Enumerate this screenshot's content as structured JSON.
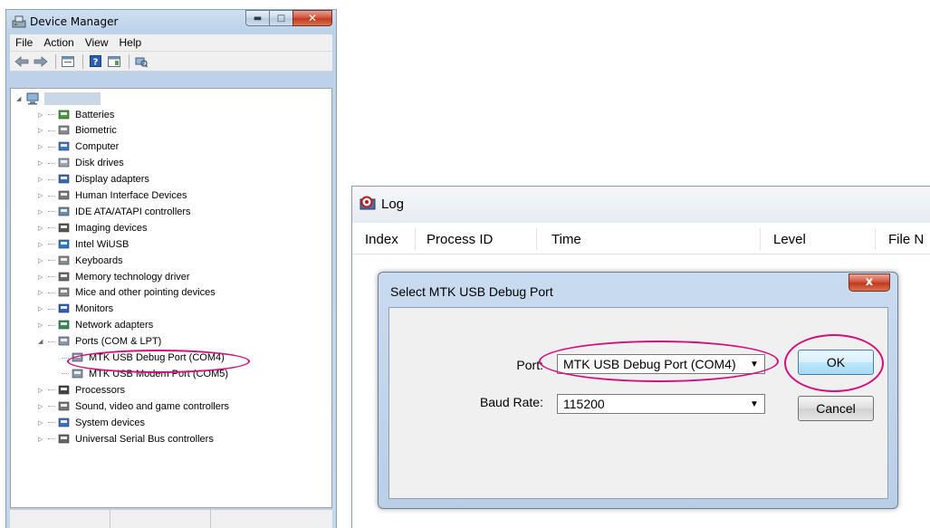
{
  "device_manager": {
    "title": "Device Manager",
    "menu": [
      "File",
      "Action",
      "View",
      "Help"
    ],
    "toolbar_icons": [
      "back-arrow-icon",
      "forward-arrow-icon",
      "properties-icon",
      "help-icon",
      "show-hide-icon",
      "scan-hardware-icon"
    ],
    "tree": {
      "categories": [
        {
          "label": "Batteries",
          "icon": "battery-icon"
        },
        {
          "label": "Biometric",
          "icon": "biometric-icon"
        },
        {
          "label": "Computer",
          "icon": "computer-icon"
        },
        {
          "label": "Disk drives",
          "icon": "disk-drive-icon"
        },
        {
          "label": "Display adapters",
          "icon": "display-adapter-icon"
        },
        {
          "label": "Human Interface Devices",
          "icon": "hid-icon"
        },
        {
          "label": "IDE ATA/ATAPI controllers",
          "icon": "ide-controller-icon"
        },
        {
          "label": "Imaging devices",
          "icon": "camera-icon"
        },
        {
          "label": "Intel WiUSB",
          "icon": "usb-network-icon"
        },
        {
          "label": "Keyboards",
          "icon": "keyboard-icon"
        },
        {
          "label": "Memory technology driver",
          "icon": "memory-icon"
        },
        {
          "label": "Mice and other pointing devices",
          "icon": "mouse-icon"
        },
        {
          "label": "Monitors",
          "icon": "monitor-icon"
        },
        {
          "label": "Network adapters",
          "icon": "network-adapter-icon"
        },
        {
          "label": "Ports (COM & LPT)",
          "icon": "port-icon"
        },
        {
          "label": "MTK USB Debug Port (COM4)",
          "icon": "port-icon"
        },
        {
          "label": "MTK USB Modem Port (COM5)",
          "icon": "port-icon"
        },
        {
          "label": "Processors",
          "icon": "processor-icon"
        },
        {
          "label": "Sound, video and game controllers",
          "icon": "sound-icon"
        },
        {
          "label": "System devices",
          "icon": "system-devices-icon"
        },
        {
          "label": "Universal Serial Bus controllers",
          "icon": "usb-icon"
        }
      ]
    }
  },
  "log_window": {
    "title": "Log",
    "columns": [
      "Index",
      "Process ID",
      "Time",
      "Level",
      "File N"
    ]
  },
  "dialog": {
    "title": "Select MTK USB Debug Port",
    "close_label": "x",
    "port_label": "Port:",
    "port_value": "MTK USB Debug Port (COM4)",
    "baud_label": "Baud Rate:",
    "baud_value": "115200",
    "ok_label": "OK",
    "cancel_label": "Cancel"
  },
  "colors": {
    "highlight_ellipse": "#d3107c"
  }
}
